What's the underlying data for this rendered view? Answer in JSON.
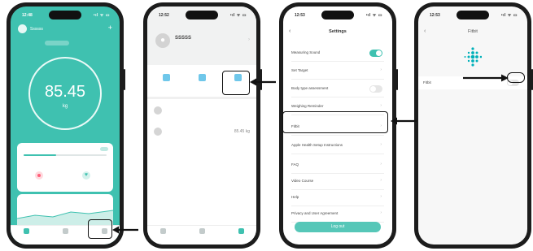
{
  "phone1": {
    "time": "12:48",
    "signal": "•ıl ᯤ ▭",
    "username": "Ssssss",
    "date_pill": "",
    "timestamp": "",
    "weight": "85.45",
    "unit": "kg",
    "bar_left_label": "",
    "bar_right_label": "",
    "goal_label": "",
    "heart_label": "",
    "trend_title": "",
    "tabs": [
      {
        "label": ""
      },
      {
        "label": ""
      },
      {
        "label": ""
      }
    ]
  },
  "phone2": {
    "time": "12:52",
    "signal": "•ıl ᯤ ▭",
    "profile_name": "SSSSS",
    "profile_id": "",
    "quick_actions": [
      {
        "label": ""
      },
      {
        "label": ""
      },
      {
        "label": ""
      }
    ],
    "users": [
      {
        "name": "",
        "date": "",
        "weight": ""
      },
      {
        "name": "",
        "date": "",
        "weight": "85.45 kg"
      }
    ],
    "tabs": [
      {
        "label": ""
      },
      {
        "label": ""
      },
      {
        "label": ""
      }
    ]
  },
  "phone3": {
    "time": "12:53",
    "signal": "•ıl ᯤ ▭",
    "back": "‹",
    "title": "Settings",
    "items": [
      {
        "label": "Measuring Sound",
        "control": "switch-on"
      },
      {
        "label": "Set Target",
        "control": "chevron"
      },
      {
        "label": "Body type assessment",
        "control": "switch-off"
      },
      {
        "label": "Weighing Reminder",
        "control": "chevron"
      },
      {
        "label": "Fitbit",
        "control": "chevron"
      },
      {
        "label": "Apple Health Setup Instructions",
        "control": "chevron"
      },
      {
        "label": "FAQ",
        "control": "chevron"
      },
      {
        "label": "Video Course",
        "control": "chevron"
      },
      {
        "label": "Help",
        "control": "chevron"
      },
      {
        "label": "Privacy and User Agreement",
        "control": "chevron"
      }
    ],
    "logout": "Log out"
  },
  "phone4": {
    "time": "12:53",
    "signal": "•ıl ᯤ ▭",
    "back": "‹",
    "title": "Fitbit",
    "row_label": "Fitbit",
    "note": "",
    "link": ""
  },
  "colors": {
    "brand": "#3fc1b0",
    "fitbit": "#00b0b9"
  }
}
